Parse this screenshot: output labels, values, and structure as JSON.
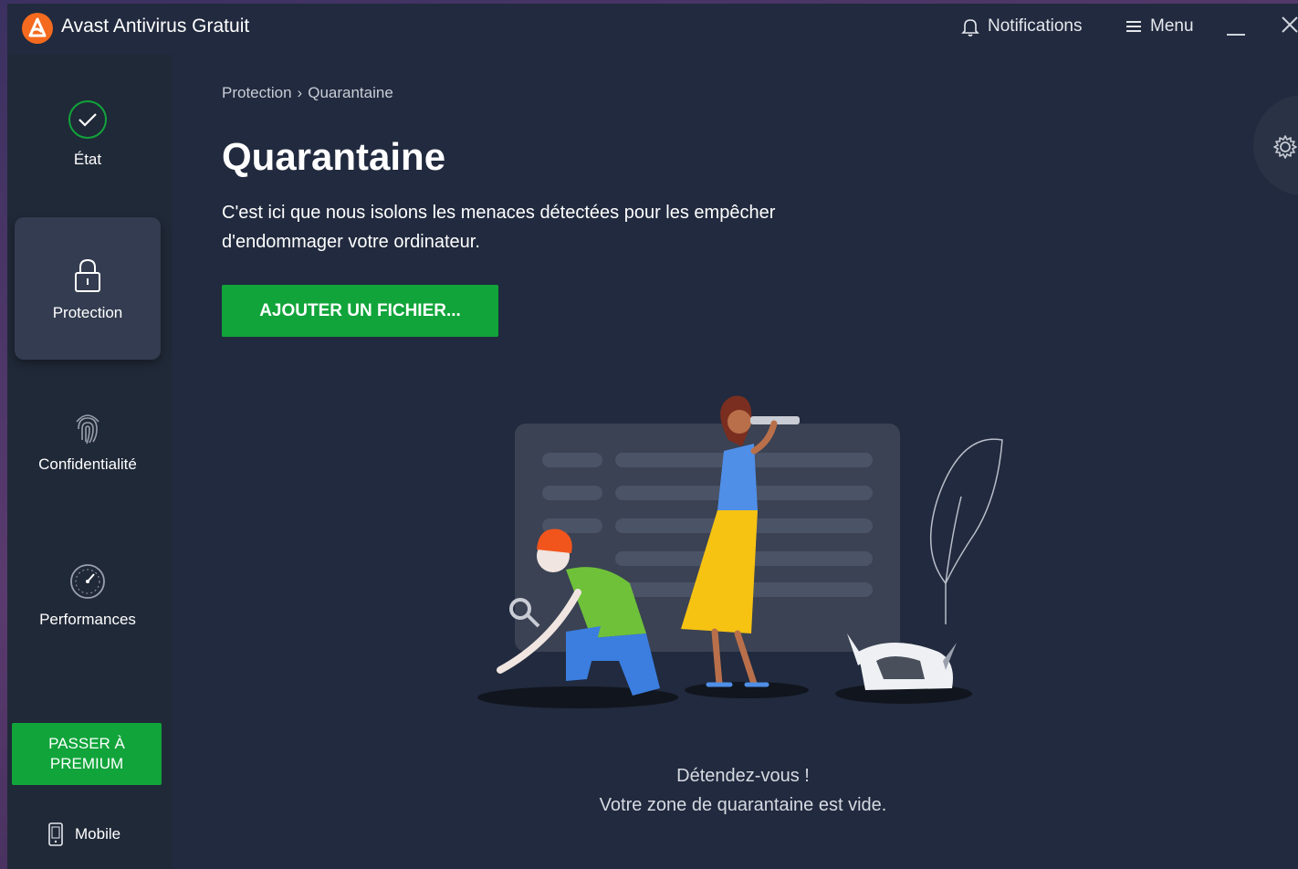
{
  "app": {
    "title": "Avast Antivirus Gratuit"
  },
  "titlebar": {
    "notifications_label": "Notifications",
    "menu_label": "Menu"
  },
  "sidebar": {
    "items": [
      {
        "label": "État",
        "icon": "check-circle-icon",
        "active": false
      },
      {
        "label": "Protection",
        "icon": "lock-icon",
        "active": true
      },
      {
        "label": "Confidentialité",
        "icon": "fingerprint-icon",
        "active": false
      },
      {
        "label": "Performances",
        "icon": "speedometer-icon",
        "active": false
      }
    ],
    "premium_label": "PASSER À PREMIUM",
    "mobile_label": "Mobile"
  },
  "main": {
    "breadcrumb": {
      "parent": "Protection",
      "separator": "›",
      "current": "Quarantaine"
    },
    "title": "Quarantaine",
    "description": "C'est ici que nous isolons les menaces détectées pour les empêcher d'endommager votre ordinateur.",
    "add_button_label": "AJOUTER UN FICHIER...",
    "empty_title": "Détendez-vous !",
    "empty_subtitle": "Votre zone de quarantaine est vide."
  },
  "colors": {
    "accent_green": "#11a43a",
    "background": "#212a3e",
    "sidebar": "#202938",
    "brand_orange": "#f46a1e"
  }
}
